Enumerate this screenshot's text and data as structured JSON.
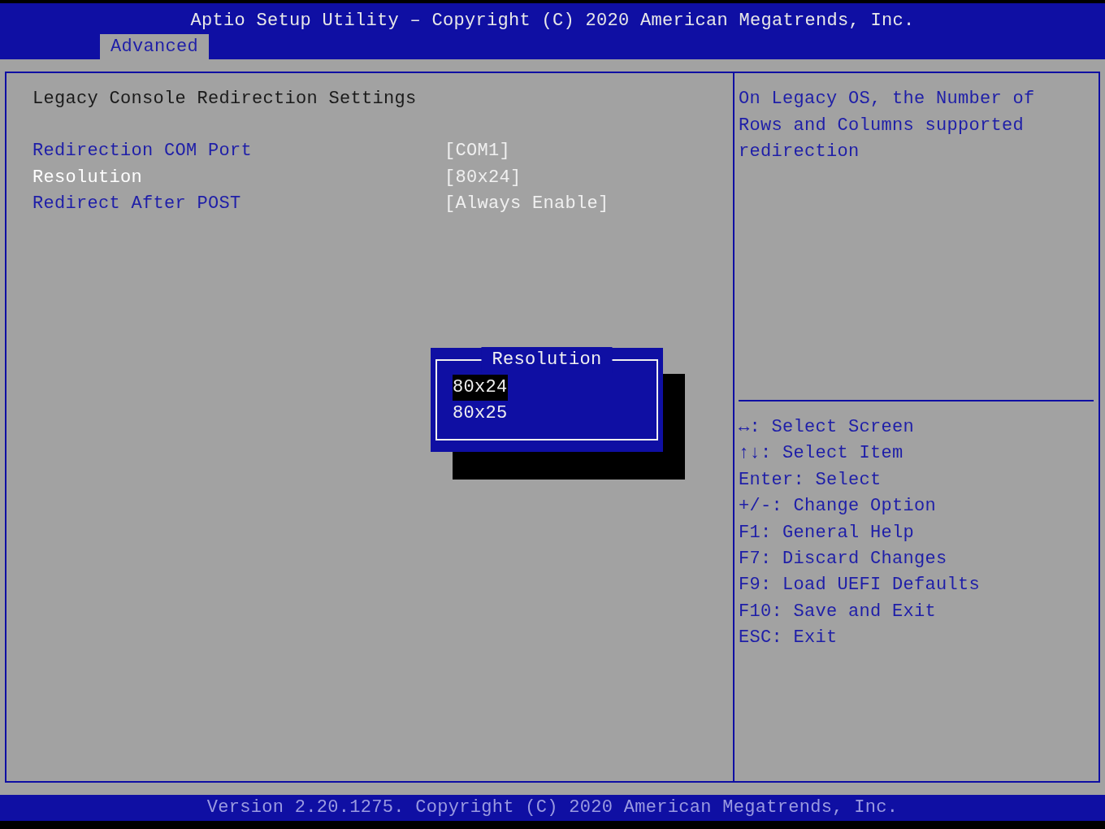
{
  "header": {
    "title": "Aptio Setup Utility – Copyright (C) 2020 American Megatrends, Inc.",
    "tabs": [
      {
        "label": "Advanced",
        "selected": true
      }
    ]
  },
  "page": {
    "heading": "Legacy Console Redirection Settings",
    "items": [
      {
        "label": "Redirection COM Port",
        "value": "[COM1]",
        "selected": false
      },
      {
        "label": "Resolution",
        "value": "[80x24]",
        "selected": true
      },
      {
        "label": "Redirect After POST",
        "value": "[Always Enable]",
        "selected": false
      }
    ]
  },
  "help": {
    "text": "On Legacy OS, the Number of Rows and Columns supported redirection",
    "keys": [
      "↔: Select Screen",
      "↑↓: Select Item",
      "Enter: Select",
      "+/-: Change Option",
      "F1: General Help",
      "F7: Discard Changes",
      "F9: Load UEFI Defaults",
      "F10: Save and Exit",
      "ESC: Exit"
    ]
  },
  "popup": {
    "title": "Resolution",
    "options": [
      {
        "label": "80x24",
        "selected": true
      },
      {
        "label": "80x25",
        "selected": false
      }
    ]
  },
  "footer": {
    "text": "Version 2.20.1275. Copyright (C) 2020 American Megatrends, Inc."
  }
}
